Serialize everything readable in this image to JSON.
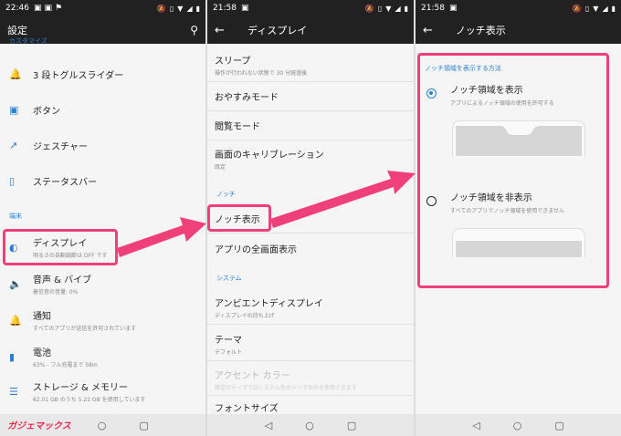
{
  "status": {
    "left_time": "22:46",
    "middle_time": "21:58",
    "right_time": "21:58"
  },
  "panel1": {
    "title": "設定",
    "partial_section": "カスタマイズ",
    "items": [
      {
        "title": "3 段トグルスライダー",
        "sub": ""
      },
      {
        "title": "ボタン",
        "sub": ""
      },
      {
        "title": "ジェスチャー",
        "sub": ""
      },
      {
        "title": "ステータスバー",
        "sub": ""
      }
    ],
    "device_section": "端末",
    "device_items": [
      {
        "title": "ディスプレイ",
        "sub": "明るさの自動調節は OFF です"
      },
      {
        "title": "音声 & バイブ",
        "sub": "着信音の音量: 0%"
      },
      {
        "title": "通知",
        "sub": "すべてのアプリが送信を許可されています"
      },
      {
        "title": "電池",
        "sub": "63% - フル充電まで 58m"
      },
      {
        "title": "ストレージ & メモリー",
        "sub": "62.01 GB のうち 5.22 GB を使用しています"
      }
    ],
    "logo": "ガジェマックス"
  },
  "panel2": {
    "title": "ディスプレイ",
    "rows_top": [
      {
        "title": "スリープ",
        "sub": "操作が行われない状態で 30 分経過後"
      },
      {
        "title": "おやすみモード",
        "sub": ""
      },
      {
        "title": "閲覧モード",
        "sub": ""
      },
      {
        "title": "画面のキャリブレーション",
        "sub": "既定"
      }
    ],
    "notch_section": "ノッチ",
    "notch_rows": [
      {
        "title": "ノッチ表示",
        "sub": ""
      },
      {
        "title": "アプリの全画面表示",
        "sub": ""
      }
    ],
    "system_section": "システム",
    "system_rows": [
      {
        "title": "アンビエントディスプレイ",
        "sub": "ディスプレイの持ち上げ"
      },
      {
        "title": "テーマ",
        "sub": "デフォルト"
      },
      {
        "title": "アクセント カラー",
        "sub": "既定のテーマではシステム色のテーマのみを使用できます"
      },
      {
        "title": "フォントサイズ",
        "sub": ""
      }
    ]
  },
  "panel3": {
    "title": "ノッチ表示",
    "section": "ノッチ領域を表示する方法",
    "options": [
      {
        "title": "ノッチ領域を表示",
        "sub": "アプリによるノッチ領域の使用を許可する",
        "selected": true
      },
      {
        "title": "ノッチ領域を非表示",
        "sub": "すべてのアプリでノッチ領域を使用できません",
        "selected": false
      }
    ]
  },
  "colors": {
    "accent": "#2a7fd4",
    "highlight": "#f0407a",
    "toolbar": "#212121"
  }
}
